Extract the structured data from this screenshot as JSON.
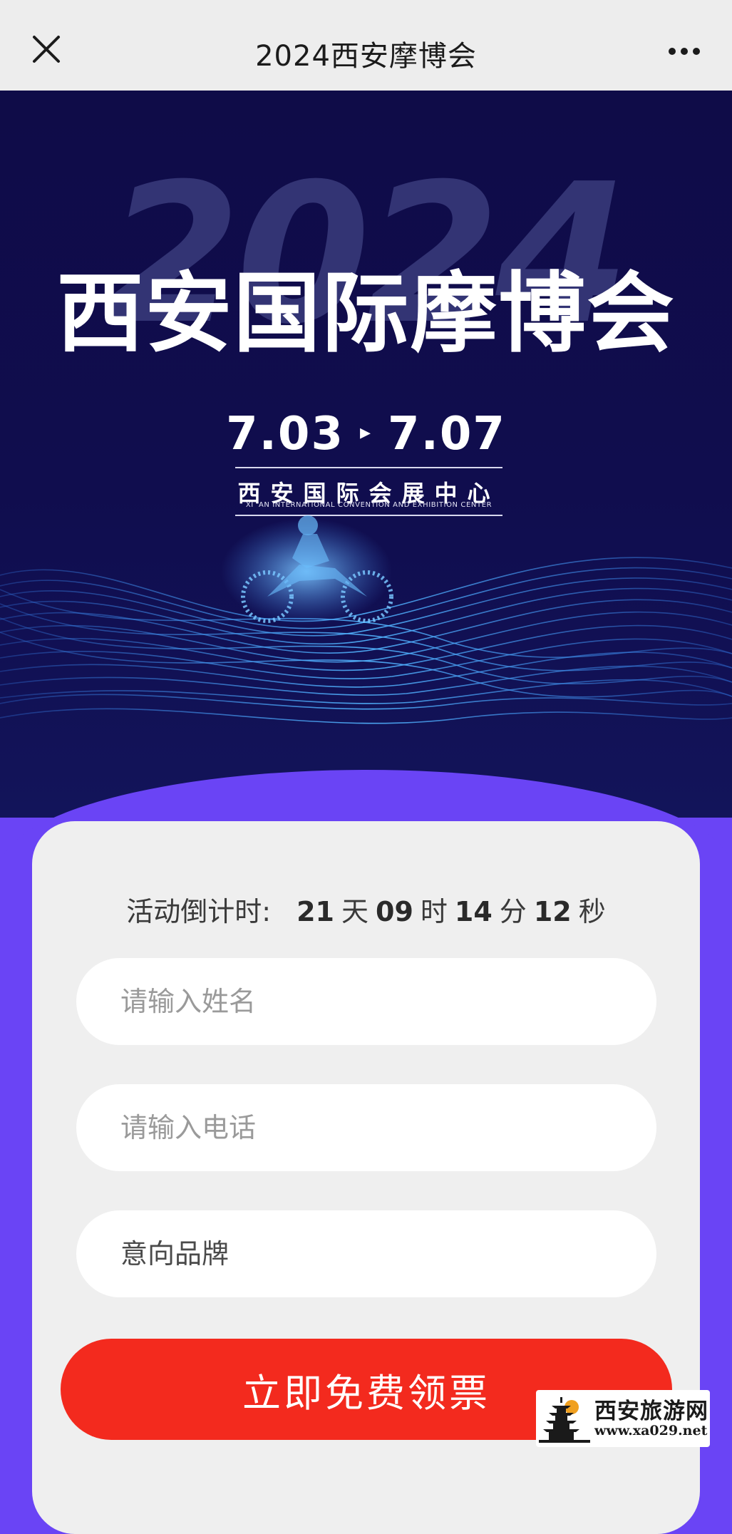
{
  "nav": {
    "title": "2024西安摩博会",
    "close_icon": "close-icon",
    "more_icon": "more-dots-icon"
  },
  "hero": {
    "year": "2024",
    "title": "西安国际摩博会",
    "date_start": "7.03",
    "date_end": "7.07",
    "arrow": "▸",
    "venue_cn": "西安国际会展中心",
    "venue_en": "XI 'AN INTERNATIONAL CONVENTION AND EXHIBITION CENTER"
  },
  "form": {
    "countdown_label": "活动倒计时:",
    "countdown": [
      {
        "value": "21",
        "unit": "天"
      },
      {
        "value": "09",
        "unit": "时"
      },
      {
        "value": "14",
        "unit": "分"
      },
      {
        "value": "12",
        "unit": "秒"
      }
    ],
    "name_placeholder": "请输入姓名",
    "phone_placeholder": "请输入电话",
    "brand_placeholder": "意向品牌",
    "submit_label": "立即免费领票"
  },
  "watermark": {
    "text_cn": "西安旅游网",
    "url": "www.xa029.net",
    "logo_icon": "pagoda-logo-icon"
  },
  "colors": {
    "nav_bg": "#ededed",
    "hero_bg": "#100d4e",
    "panel_purple": "#6a44f5",
    "card_bg": "#efefef",
    "submit_red": "#f32a1e"
  }
}
